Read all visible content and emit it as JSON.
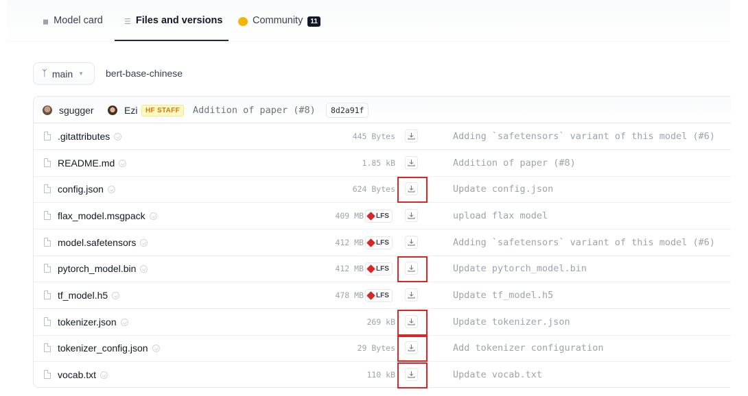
{
  "tabs": [
    {
      "label": "Model card",
      "icon": "model-card-icon"
    },
    {
      "label": "Files and versions",
      "icon": "files-icon",
      "active": true
    },
    {
      "label": "Community",
      "icon": "community-icon",
      "count": "11"
    }
  ],
  "branch": {
    "label": "main",
    "icon": "branch-icon"
  },
  "repo": {
    "name": "bert-base-chinese"
  },
  "last_commit": {
    "authors": [
      "sgugger",
      "Ezi"
    ],
    "badge": "HF STAFF",
    "message": "Addition of paper (#8)",
    "hash": "8d2a91f"
  },
  "files": [
    {
      "name": ".gitattributes",
      "size": "445 Bytes",
      "lfs": false,
      "commit": "Adding `safetensors` variant of this model (#6)",
      "highlighted": false
    },
    {
      "name": "README.md",
      "size": "1.85 kB",
      "lfs": false,
      "commit": "Addition of paper (#8)",
      "highlighted": false
    },
    {
      "name": "config.json",
      "size": "624 Bytes",
      "lfs": false,
      "commit": "Update config.json",
      "highlighted": true
    },
    {
      "name": "flax_model.msgpack",
      "size": "409 MB",
      "lfs": true,
      "commit": "upload flax model",
      "highlighted": false
    },
    {
      "name": "model.safetensors",
      "size": "412 MB",
      "lfs": true,
      "commit": "Adding `safetensors` variant of this model (#6)",
      "highlighted": false
    },
    {
      "name": "pytorch_model.bin",
      "size": "412 MB",
      "lfs": true,
      "commit": "Update pytorch_model.bin",
      "highlighted": true
    },
    {
      "name": "tf_model.h5",
      "size": "478 MB",
      "lfs": true,
      "commit": "Update tf_model.h5",
      "highlighted": false
    },
    {
      "name": "tokenizer.json",
      "size": "269 kB",
      "lfs": false,
      "commit": "Update tokenizer.json",
      "highlighted": true
    },
    {
      "name": "tokenizer_config.json",
      "size": "29 Bytes",
      "lfs": false,
      "commit": "Add tokenizer configuration",
      "highlighted": true
    },
    {
      "name": "vocab.txt",
      "size": "110 kB",
      "lfs": false,
      "commit": "Update vocab.txt",
      "highlighted": true
    }
  ],
  "lfs_label": "LFS",
  "colors": {
    "highlight": "#dc2626",
    "accent": "#111827",
    "staff_badge": "#d97706"
  }
}
